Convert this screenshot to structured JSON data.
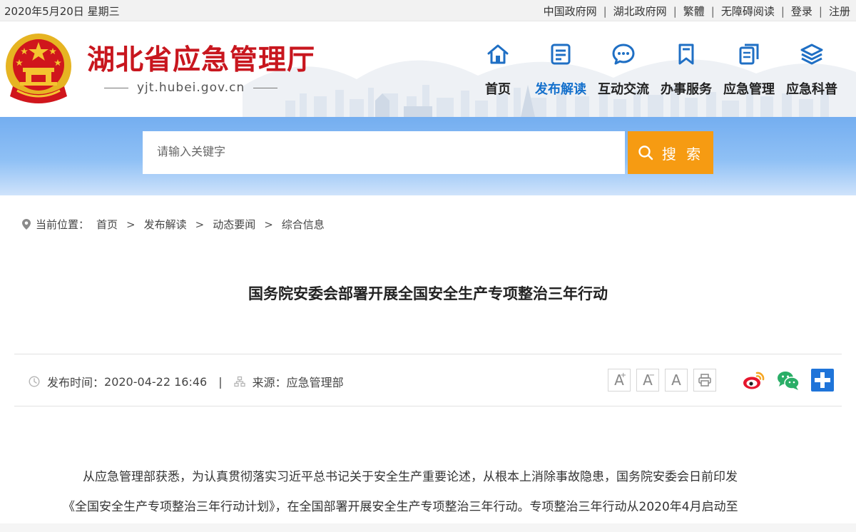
{
  "topbar": {
    "date": "2020年5月20日 星期三",
    "links": [
      "中国政府网",
      "湖北政府网",
      "繁體",
      "无障碍阅读",
      "登录",
      "注册"
    ]
  },
  "header": {
    "site_title": "湖北省应急管理厅",
    "domain": "yjt.hubei.gov.cn",
    "nav": [
      {
        "label": "首页",
        "icon": "home-icon"
      },
      {
        "label": "发布解读",
        "icon": "document-icon"
      },
      {
        "label": "互动交流",
        "icon": "chat-icon"
      },
      {
        "label": "办事服务",
        "icon": "bookmark-icon"
      },
      {
        "label": "应急管理",
        "icon": "files-icon"
      },
      {
        "label": "应急科普",
        "icon": "layers-icon"
      }
    ],
    "active_nav": "发布解读"
  },
  "search": {
    "placeholder": "请输入关键字",
    "button_label": "搜 索"
  },
  "breadcrumb": {
    "prefix": "当前位置：",
    "items": [
      "首页",
      "发布解读",
      "动态要闻",
      "综合信息"
    ],
    "separator": ">"
  },
  "article": {
    "title": "国务院安委会部署开展全国安全生产专项整治三年行动",
    "publish_label": "发布时间：",
    "publish_time": "2020-04-22 16:46",
    "source_label": "来源：",
    "source": "应急管理部",
    "font_controls": [
      "A",
      "A",
      "A"
    ],
    "paragraph_line1": "从应急管理部获悉，为认真贯彻落实习近平总书记关于安全生产重要论述，从根本上消除事故隐患，国务院安委会日前印发",
    "paragraph_line2": "《全国安全生产专项整治三年行动计划》，在全国部署开展安全生产专项整治三年行动。专项整治三年行动从2020年4月启动至"
  },
  "colors": {
    "brand_red": "#c8161e",
    "nav_active": "#1470cc",
    "search_button": "#f69b12",
    "search_band": "#74aef0",
    "nav_icon": "#1f6fc4"
  }
}
